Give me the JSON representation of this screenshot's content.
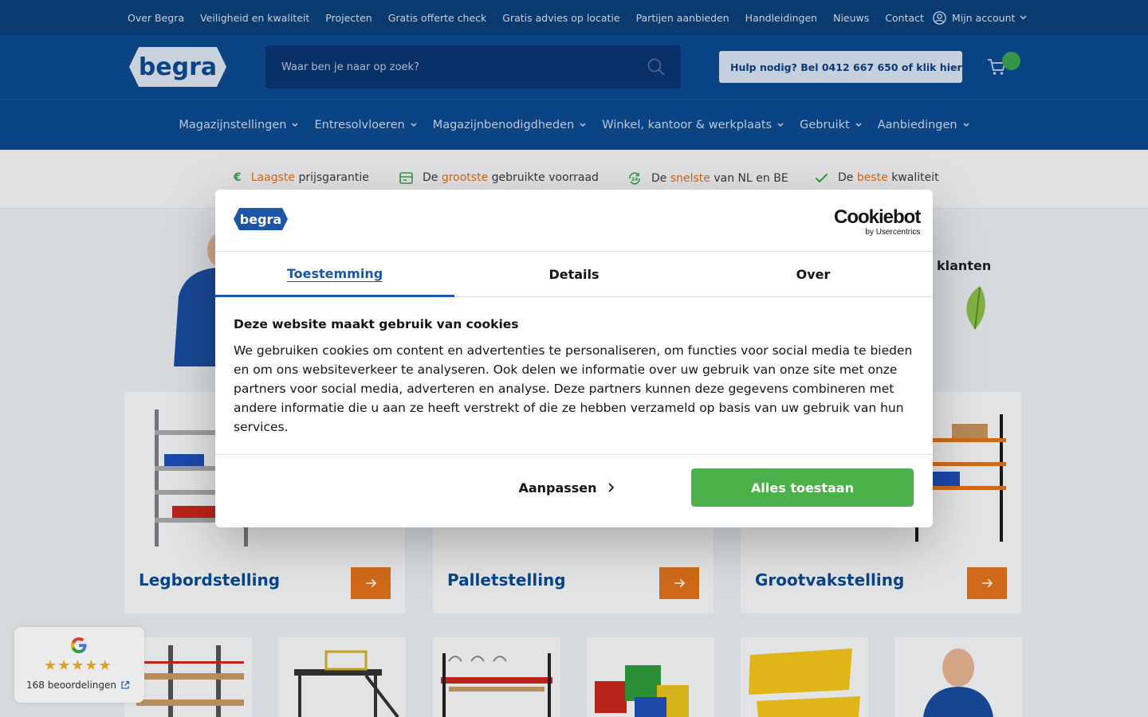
{
  "topbar": {
    "links": [
      "Over Begra",
      "Veiligheid en kwaliteit",
      "Projecten",
      "Gratis offerte check",
      "Gratis advies op locatie",
      "Partijen aanbieden",
      "Handleidingen",
      "Nieuws",
      "Contact"
    ],
    "account_label": "Mijn account"
  },
  "header": {
    "logo_text": "begra",
    "search_placeholder": "Waar ben je naar op zoek?",
    "help_label": "Hulp nodig? Bel 0412 667 650 of klik hier"
  },
  "mainnav": [
    "Magazijnstellingen",
    "Entresolvloeren",
    "Magazijnbenodigdheden",
    "Winkel, kantoor & werkplaats",
    "Gebruikt",
    "Aanbiedingen"
  ],
  "usps": [
    {
      "icon": "euro-icon",
      "pre": "",
      "highlight": "Laagste",
      "post": " prijsgarantie"
    },
    {
      "icon": "stock-icon",
      "pre": "De ",
      "highlight": "grootste",
      "post": " gebruikte voorraad"
    },
    {
      "icon": "fast-delivery-icon",
      "pre": "De ",
      "highlight": "snelste",
      "post": " van NL en BE"
    },
    {
      "icon": "check-icon",
      "pre": "De ",
      "highlight": "beste",
      "post": " kwaliteit"
    }
  ],
  "hero": {
    "partial_text": "klanten"
  },
  "categories": [
    {
      "label": "Legbordstelling"
    },
    {
      "label": "Palletstelling"
    },
    {
      "label": "Grootvakstelling"
    }
  ],
  "reviews": {
    "stars": "★★★★★",
    "count_label": "168 beoordelingen"
  },
  "cookie_dialog": {
    "logo_text": "begra",
    "provider": "Cookiebot",
    "provider_sub": "by Usercentrics",
    "tabs": [
      "Toestemming",
      "Details",
      "Over"
    ],
    "active_tab": "Toestemming",
    "title": "Deze website maakt gebruik van cookies",
    "body": "We gebruiken cookies om content en advertenties te personaliseren, om functies voor social media te bieden en om ons websiteverkeer te analyseren. Ook delen we informatie over uw gebruik van onze site met onze partners voor social media, adverteren en analyse. Deze partners kunnen deze gegevens combineren met andere informatie die u aan ze heeft verstrekt of die ze hebben verzameld op basis van uw gebruik van hun services.",
    "customize_label": "Aanpassen",
    "allow_label": "Alles toestaan"
  },
  "colors": {
    "brand_blue": "#0c4a91",
    "accent_orange": "#e0731c",
    "allow_green": "#4cb14a",
    "tab_active": "#1a58a7"
  }
}
